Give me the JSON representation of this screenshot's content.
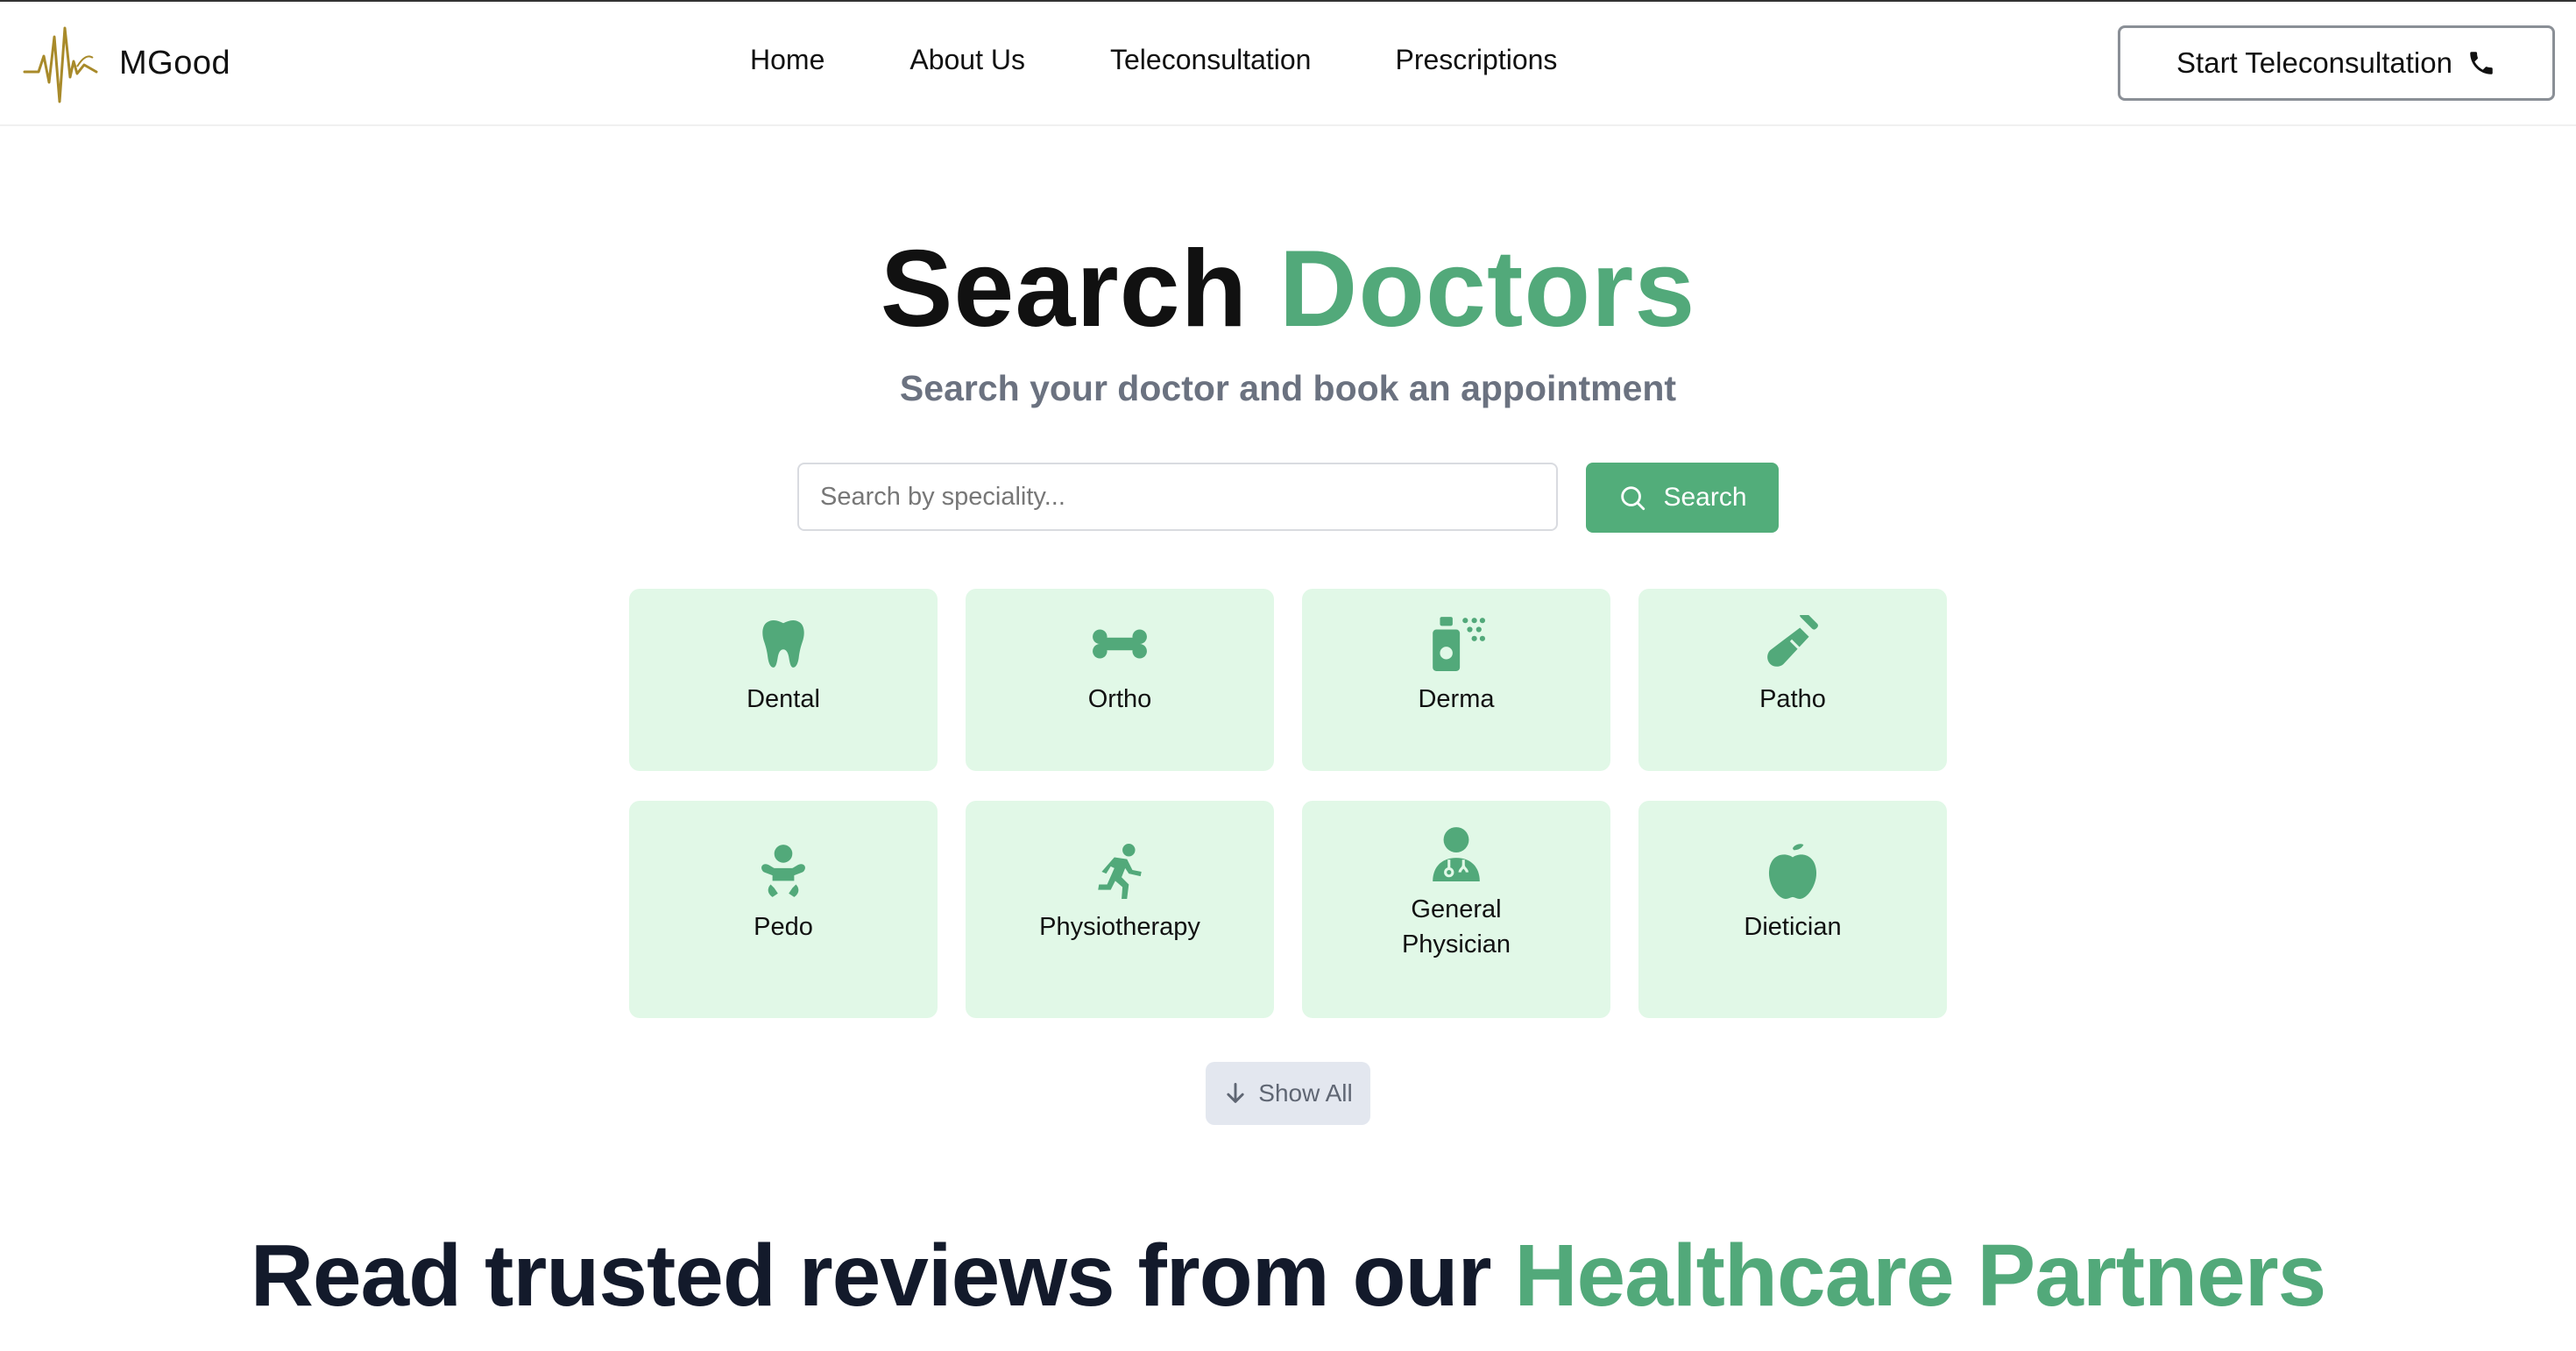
{
  "brand": {
    "name": "MGood"
  },
  "nav": {
    "items": [
      {
        "label": "Home"
      },
      {
        "label": "About Us"
      },
      {
        "label": "Teleconsultation"
      },
      {
        "label": "Prescriptions"
      }
    ],
    "cta_label": "Start Teleconsultation",
    "cta_icon": "phone-icon"
  },
  "hero": {
    "title_part1": "Search",
    "title_part2": "Doctors",
    "subtitle": "Search your doctor and book an appointment"
  },
  "search": {
    "placeholder": "Search by speciality...",
    "button_label": "Search"
  },
  "specialities": [
    {
      "label": "Dental",
      "icon": "tooth-icon"
    },
    {
      "label": "Ortho",
      "icon": "bone-icon"
    },
    {
      "label": "Derma",
      "icon": "spray-bottle-icon"
    },
    {
      "label": "Patho",
      "icon": "test-tube-icon"
    },
    {
      "label": "Pedo",
      "icon": "baby-icon"
    },
    {
      "label": "Physiotherapy",
      "icon": "running-person-icon"
    },
    {
      "label": "General Physician",
      "icon": "doctor-icon"
    },
    {
      "label": "Dietician",
      "icon": "apple-icon"
    }
  ],
  "show_all_label": "Show All",
  "reviews": {
    "heading_part1": "Read trusted reviews from our",
    "heading_part2": "Healthcare Partners"
  },
  "colors": {
    "accent": "#52ad7a",
    "card_bg": "#e1f8e7",
    "subtitle": "#6b7280",
    "logo_gold": "#a88a2a"
  }
}
